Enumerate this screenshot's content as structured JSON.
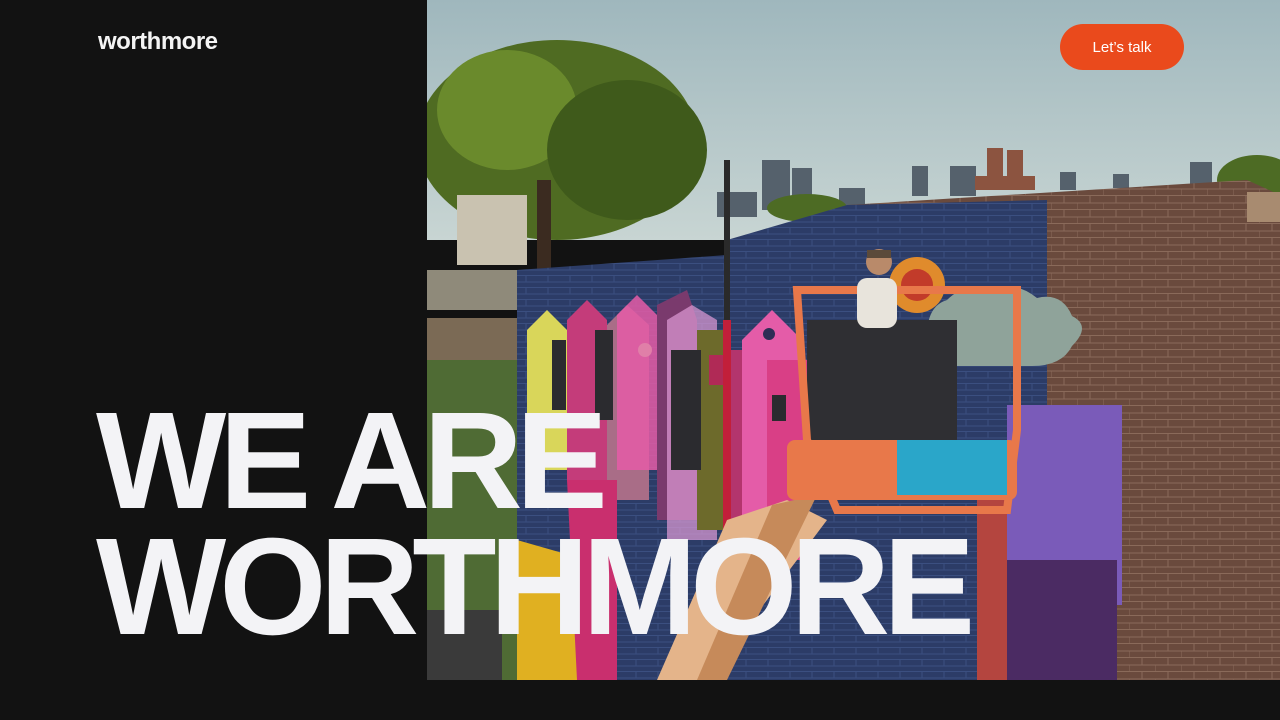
{
  "brand": {
    "logo_text": "worthmore"
  },
  "header": {
    "cta_label": "Let’s talk"
  },
  "hero": {
    "headline_line1": "WE ARE",
    "headline_line2": "WORTHMORE",
    "image_subject": "muralist on orange aerial lift painting colorful brick wall, city skyline behind"
  },
  "colors": {
    "background": "#121212",
    "accent": "#ea4a1c",
    "headline": "#f3f3f6"
  }
}
